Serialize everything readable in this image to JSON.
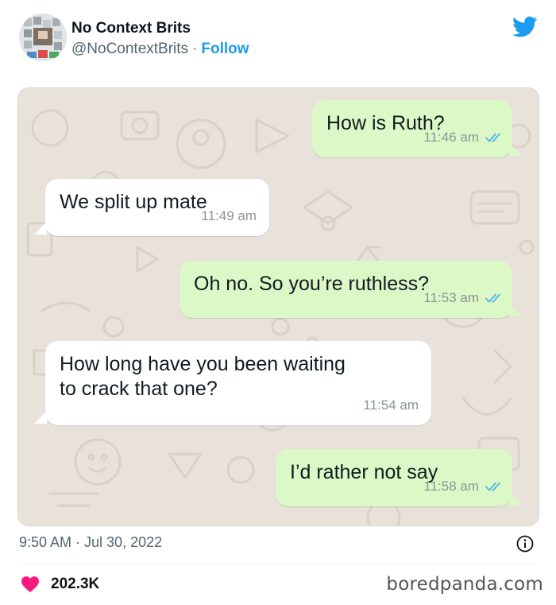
{
  "tweet": {
    "display_name": "No Context Brits",
    "handle": "@NoContextBrits",
    "separator": "·",
    "follow_label": "Follow",
    "timestamp": "9:50 AM · Jul 30, 2022",
    "like_count": "202.3K"
  },
  "chat": {
    "messages": [
      {
        "direction": "outgoing",
        "text": "How is Ruth?",
        "time": "11:46 am",
        "read": true
      },
      {
        "direction": "incoming",
        "text": "We split up mate",
        "time": "11:49 am"
      },
      {
        "direction": "outgoing",
        "text": "Oh no. So you’re ruthless?",
        "time": "11:53 am",
        "read": true
      },
      {
        "direction": "incoming",
        "text": "How long have you been waiting\nto crack that one?",
        "time": "11:54 am"
      },
      {
        "direction": "outgoing",
        "text": "I’d rather not say",
        "time": "11:58 am",
        "read": true
      }
    ]
  },
  "watermark": "boredpanda.com",
  "colors": {
    "twitter_blue": "#1d9bf0",
    "heart_red": "#f91880",
    "outgoing_bubble": "#dcf8c6",
    "incoming_bubble": "#ffffff",
    "read_tick": "#4fb6ec",
    "chat_wallpaper": "#e8e2da"
  },
  "icons": {
    "brand": "twitter-bird-icon",
    "info": "info-icon",
    "like": "heart-icon",
    "read_receipt": "double-check-icon"
  }
}
